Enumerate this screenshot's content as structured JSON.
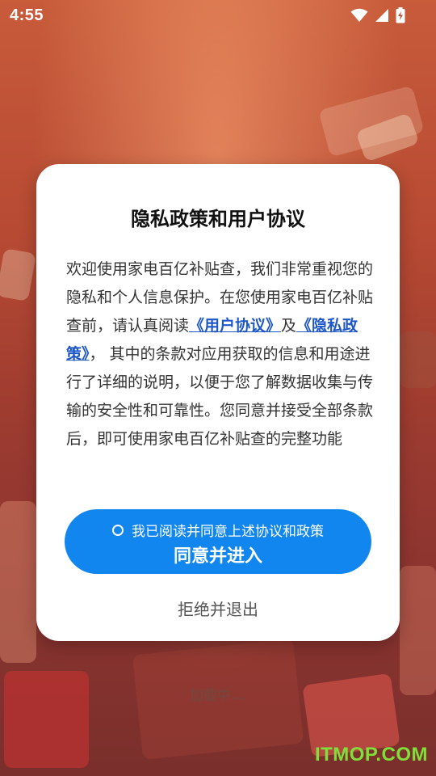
{
  "status_bar": {
    "time": "4:55",
    "icons": [
      "wifi-icon",
      "signal-icon",
      "battery-charging-icon"
    ]
  },
  "background": {
    "loading_text": "加载中..."
  },
  "dialog": {
    "title": "隐私政策和用户协议",
    "body": {
      "part1": "欢迎使用家电百亿补贴查，我们非常重视您的隐私和个人信息保护。在您使用家电百亿补贴查前，请认真阅读",
      "user_agreement_link": "《用户协议》",
      "part2": "及",
      "privacy_policy_link": "《隐私政策》",
      "part3": "， 其中的条款对应用获取的信息和用途进行了详细的说明，以便于您了解数据收集与传输的安全性和可靠性。您同意并接受全部条款后，即可使用家电百亿补贴查的完整功能"
    },
    "consent_checkbox_label": "我已阅读并同意上述协议和政策",
    "agree_button_label": "同意并进入",
    "reject_label": "拒绝并退出"
  },
  "watermark": "ITMOP.COM",
  "colors": {
    "primary": "#1186ef",
    "link": "#1e57c8",
    "background": "#b74a33"
  }
}
